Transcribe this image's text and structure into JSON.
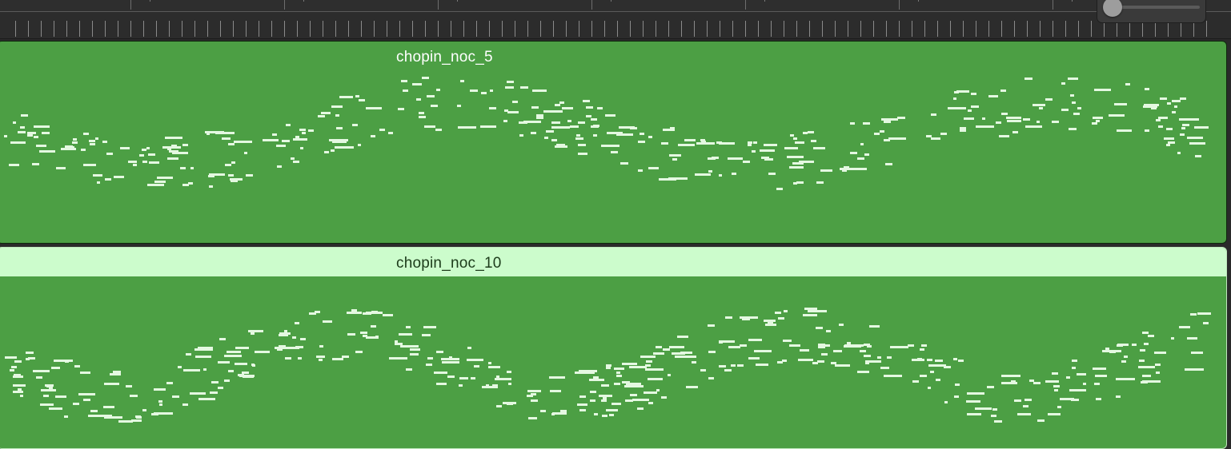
{
  "colors": {
    "region_green": "#4c9f44",
    "selected_header": "#ccfccc",
    "note_color": "#e4f8e1"
  },
  "ruler": {
    "icon": "bar-marker-icon"
  },
  "zoom_slider": {
    "icon": "zoom-slider-icon",
    "value": 0.0
  },
  "regions": [
    {
      "name": "chopin_noc_5",
      "selected": false
    },
    {
      "name": "chopin_noc_10",
      "selected": true
    }
  ]
}
